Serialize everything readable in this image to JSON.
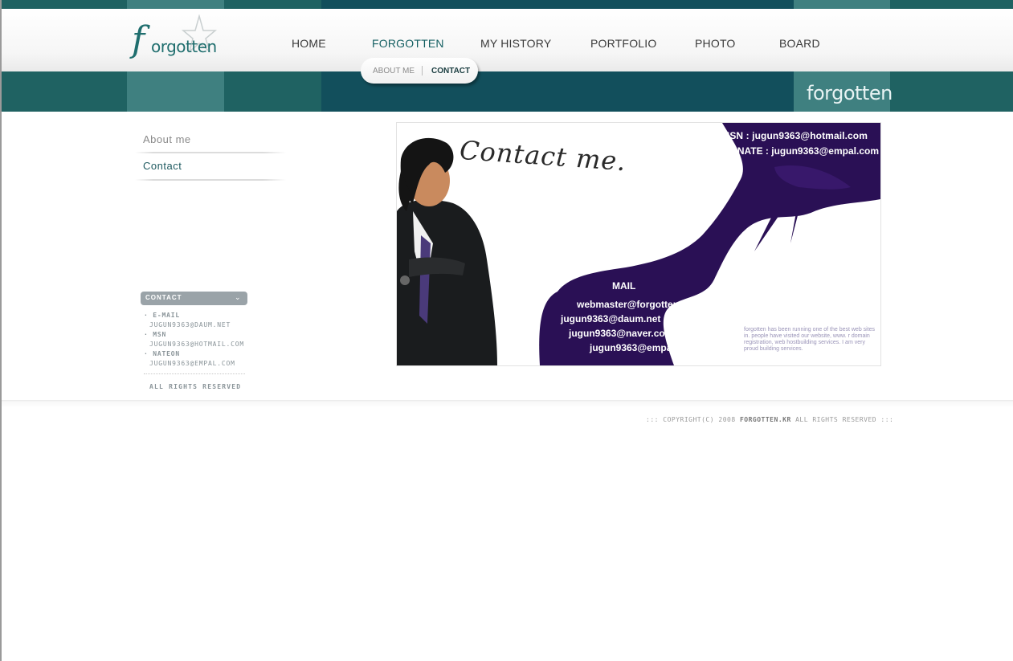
{
  "colors": {
    "teal": "#1f6262",
    "teal_dark": "#124f5c",
    "teal_light": "#3f8080",
    "ink": "#2a1055"
  },
  "logo": {
    "first_letter": "f",
    "rest": "orgotten",
    "icon": "star-icon"
  },
  "header": {
    "band_word": "forgotten"
  },
  "nav": [
    {
      "label": "HOME"
    },
    {
      "label": "FORGOTTEN"
    },
    {
      "label": "MY HISTORY"
    },
    {
      "label": "PORTFOLIO"
    },
    {
      "label": "PHOTO"
    },
    {
      "label": "BOARD"
    }
  ],
  "subnav": [
    {
      "label": "ABOUT ME"
    },
    {
      "label": "CONTACT"
    }
  ],
  "sidebar": {
    "items": [
      {
        "label": "About me"
      },
      {
        "label": "Contact"
      }
    ],
    "contact": {
      "title": "CONTACT",
      "chevron_icon": "chevron-down-icon",
      "entries": [
        {
          "label": "E-MAIL",
          "value": "JUGUN9363@DAUM.NET"
        },
        {
          "label": "MSN",
          "value": "JUGUN9363@HOTMAIL.COM"
        },
        {
          "label": "NATEON",
          "value": "JUGUN9363@EMPAL.COM"
        }
      ],
      "rights": "ALL RIGHTS RESERVED"
    }
  },
  "panel": {
    "heading": "Contact me.",
    "msn": "MSN : jugun9363@hotmail.com",
    "nate": "NATE : jugun9363@empal.com",
    "mail_heading": "MAIL",
    "mails": [
      "webmaster@forgotten.kr",
      "jugun9363@daum.net",
      "jugun9363@naver.com",
      "jugun9363@empal.com"
    ],
    "small_text": "forgotten has been running one of the best web sites in. people have visited our website, www. r domain registration, web hostbuilding services. I am very proud building services."
  },
  "footer": {
    "prefix": "::: COPYRIGHT(C) 2008 ",
    "brand": "FORGOTTEN.KR",
    "suffix": " ALL RIGHTS RESERVED :::"
  }
}
